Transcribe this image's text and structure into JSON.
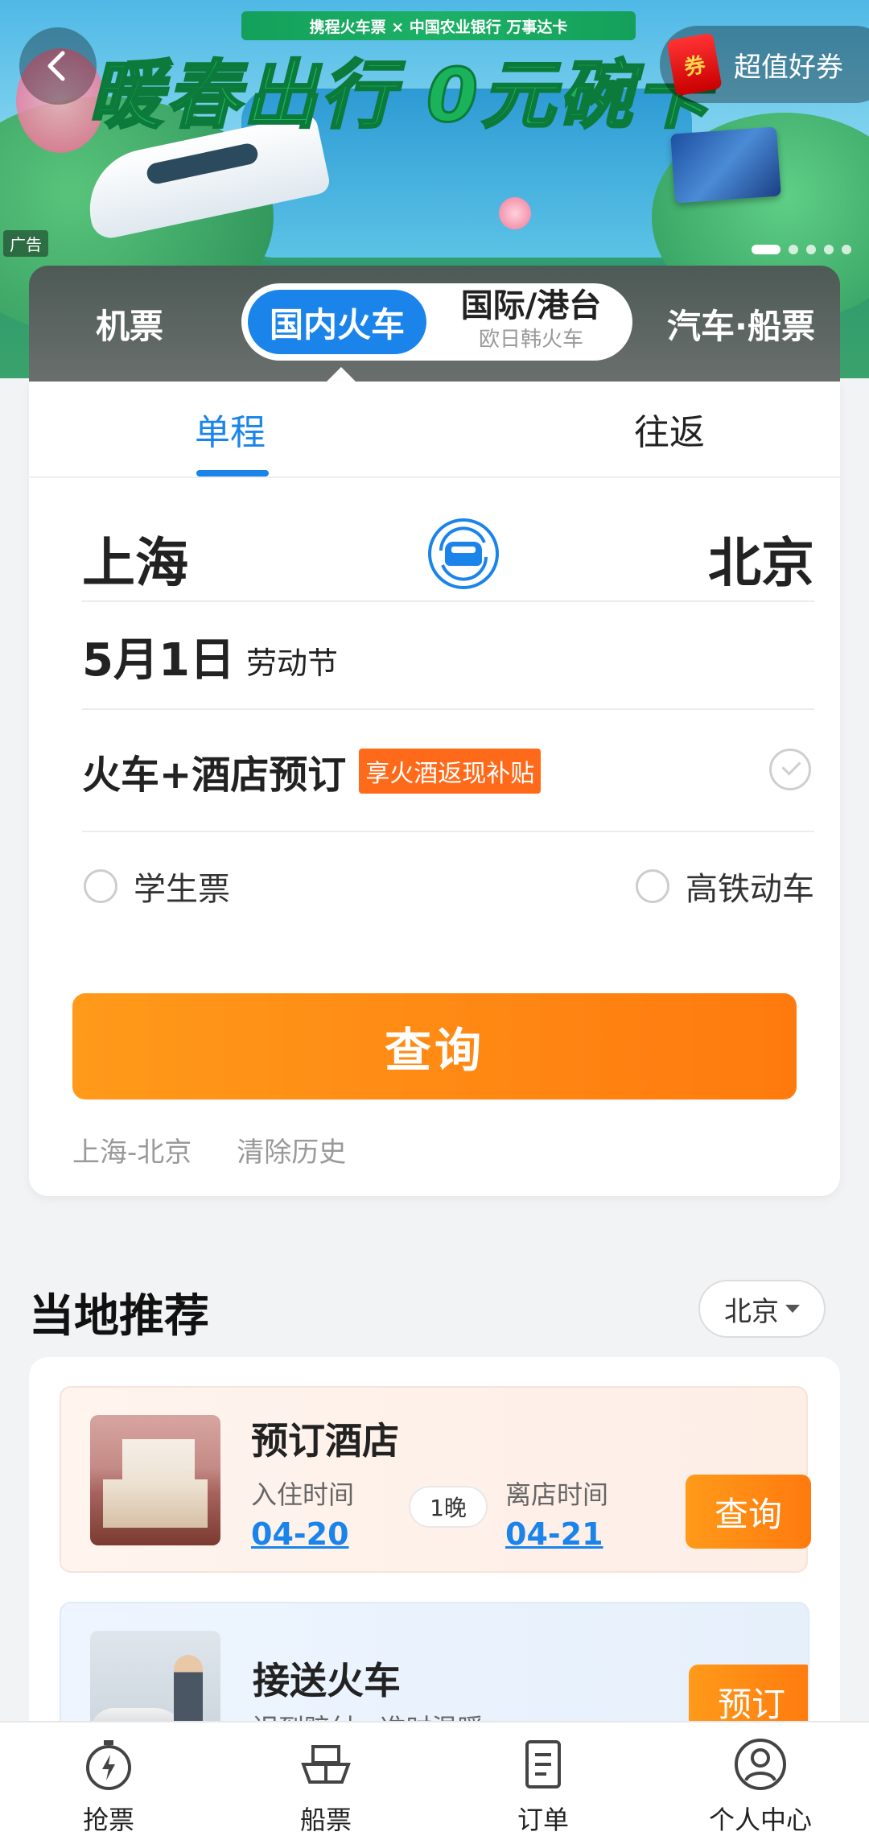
{
  "banner": {
    "brand_text": "携程火车票 × 中国农业银行 万事达卡",
    "headline": "暖春出行 0元碗卡",
    "promo_coupon": "券",
    "promo_text": "超值好券",
    "ad_label": "广告",
    "slide_count": 5,
    "active_slide": 1
  },
  "modes": {
    "flight": "机票",
    "domestic_train": "国内火车",
    "intl": "国际/港台",
    "intl_sub": "欧日韩火车",
    "bus_ship": "汽车·船票"
  },
  "trip_tabs": {
    "one_way": "单程",
    "round_trip": "往返"
  },
  "search": {
    "from": "上海",
    "to": "北京",
    "date": "5月1日",
    "holiday": "劳动节",
    "hotel_label": "火车+酒店预订",
    "hotel_badge": "享火酒返现补贴",
    "student": "学生票",
    "high_speed": "高铁动车",
    "query_button": "查询",
    "history_item": "上海-北京",
    "clear_history": "清除历史"
  },
  "recommend": {
    "title": "当地推荐",
    "city": "北京",
    "hotel": {
      "title": "预订酒店",
      "checkin_label": "入住时间",
      "checkin_date": "04-20",
      "nights": "1晚",
      "checkout_label": "离店时间",
      "checkout_date": "04-21",
      "button": "查询"
    },
    "transfer": {
      "title": "接送火车",
      "subtitle": "迟到赔付 · 准时温暖",
      "button": "预订"
    }
  },
  "tabbar": {
    "grab": "抢票",
    "ship": "船票",
    "orders": "订单",
    "profile": "个人中心"
  },
  "colors": {
    "primary": "#1a84ea",
    "accent": "#ff7a0e"
  }
}
